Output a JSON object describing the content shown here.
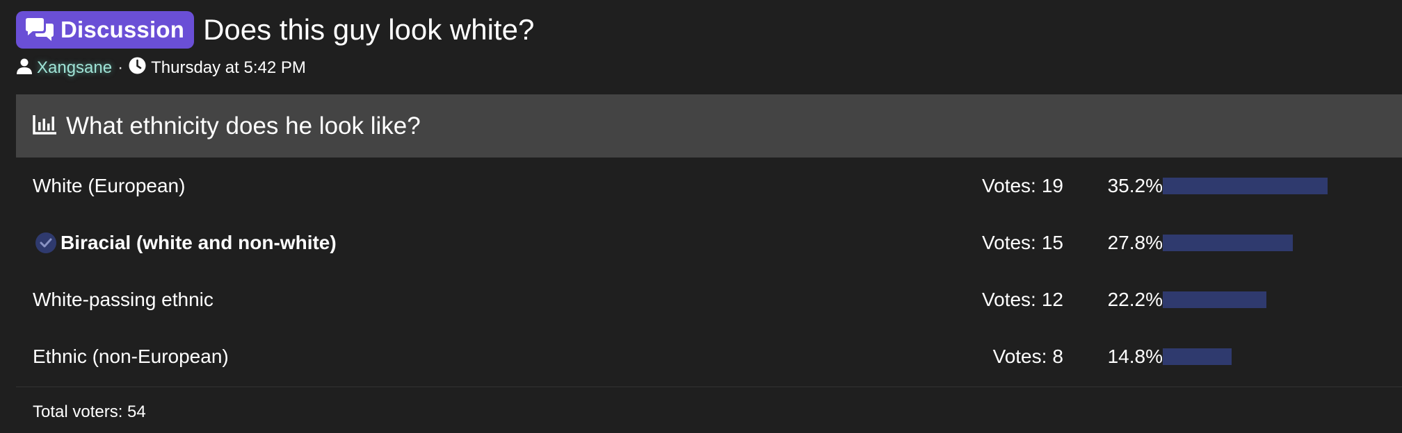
{
  "thread": {
    "prefix": "Discussion",
    "title": "Does this guy look white?",
    "author": "Xangsane",
    "separator": "·",
    "date": "Thursday at 5:42 PM"
  },
  "poll": {
    "question": "What ethnicity does he look like?",
    "votes_label": "Votes:",
    "options": [
      {
        "label": "White (European)",
        "votes": "19",
        "percent": "35.2%",
        "fraction": 0.352,
        "selected": false
      },
      {
        "label": "Biracial (white and non-white)",
        "votes": "15",
        "percent": "27.8%",
        "fraction": 0.278,
        "selected": true
      },
      {
        "label": "White-passing ethnic",
        "votes": "12",
        "percent": "22.2%",
        "fraction": 0.222,
        "selected": false
      },
      {
        "label": "Ethnic (non-European)",
        "votes": "8",
        "percent": "14.8%",
        "fraction": 0.148,
        "selected": false
      }
    ],
    "total_label": "Total voters: 54"
  },
  "colors": {
    "background": "#1f1f1f",
    "prefix_badge": "#6a4fd6",
    "poll_header": "#444444",
    "bar": "#2f3a6e",
    "username": "#9fe3d6"
  },
  "icons": {
    "prefix": "comments-icon",
    "author": "user-icon",
    "date": "clock-icon",
    "poll": "bar-chart-icon",
    "selected": "check-circle-icon"
  }
}
